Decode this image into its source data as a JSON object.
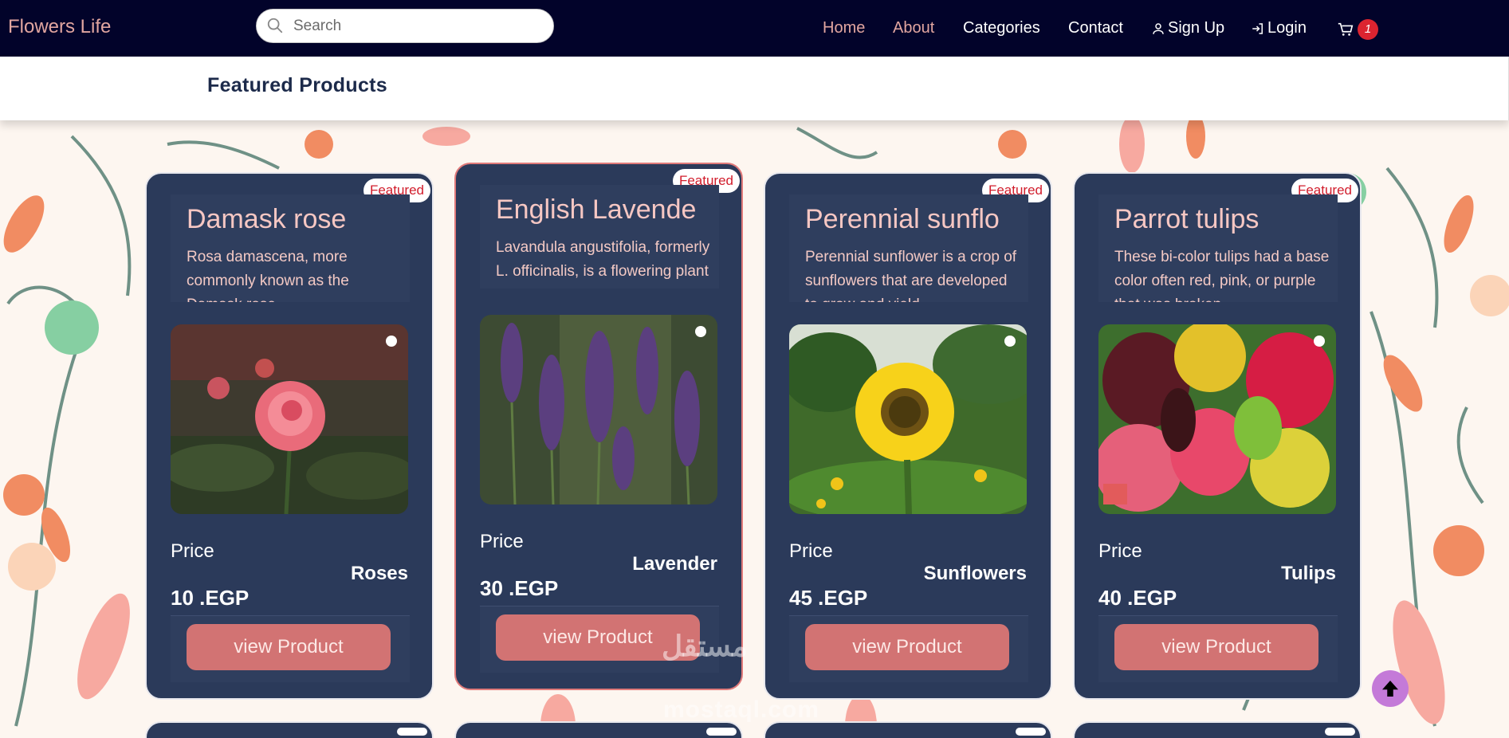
{
  "navbar": {
    "brand": "Flowers Life",
    "search_placeholder": "Search",
    "links": {
      "home": "Home",
      "about": "About",
      "categories": "Categories",
      "contact": "Contact",
      "signup": "Sign Up",
      "login": "Login"
    },
    "cart_count": "1"
  },
  "featured": {
    "title": "Featured Products"
  },
  "products": [
    {
      "badge": "Featured",
      "title": "Damask rose",
      "description": "Rosa damascena, more commonly known as the Damask rose, ...",
      "image_icon": "rose-photo",
      "price_label": "Price",
      "category": "Roses",
      "price": "10 .EGP",
      "button": "view Product"
    },
    {
      "badge": "Featured",
      "title": "English Lavende",
      "description": "Lavandula angustifolia, formerly L. officinalis, is a flowering plant in the family",
      "image_icon": "lavender-photo",
      "price_label": "Price",
      "category": "Lavender",
      "price": "30 .EGP",
      "button": "view Product"
    },
    {
      "badge": "Featured",
      "title": "Perennial sunflo",
      "description": "Perennial sunflower is a crop of sunflowers that are developed to grow and yield",
      "image_icon": "sunflower-photo",
      "price_label": "Price",
      "category": "Sunflowers",
      "price": "45 .EGP",
      "button": "view Product"
    },
    {
      "badge": "Featured",
      "title": "Parrot tulips",
      "description": "These bi-color tulips had a base color often red, pink, or purple that was broken",
      "image_icon": "tulip-photo",
      "price_label": "Price",
      "category": "Tulips",
      "price": "40 .EGP",
      "button": "view Product"
    }
  ],
  "watermark": {
    "arabic": "مستقل",
    "latin": "mostaql.com"
  },
  "colors": {
    "navbar_bg": "#02032a",
    "accent_pink": "#e2a6a0",
    "card_bg": "#2b3a5a",
    "button_bg": "#d27373",
    "badge_text": "#d11c2b",
    "cart_badge": "#dc2430",
    "to_top_bg": "#c47ad8"
  }
}
